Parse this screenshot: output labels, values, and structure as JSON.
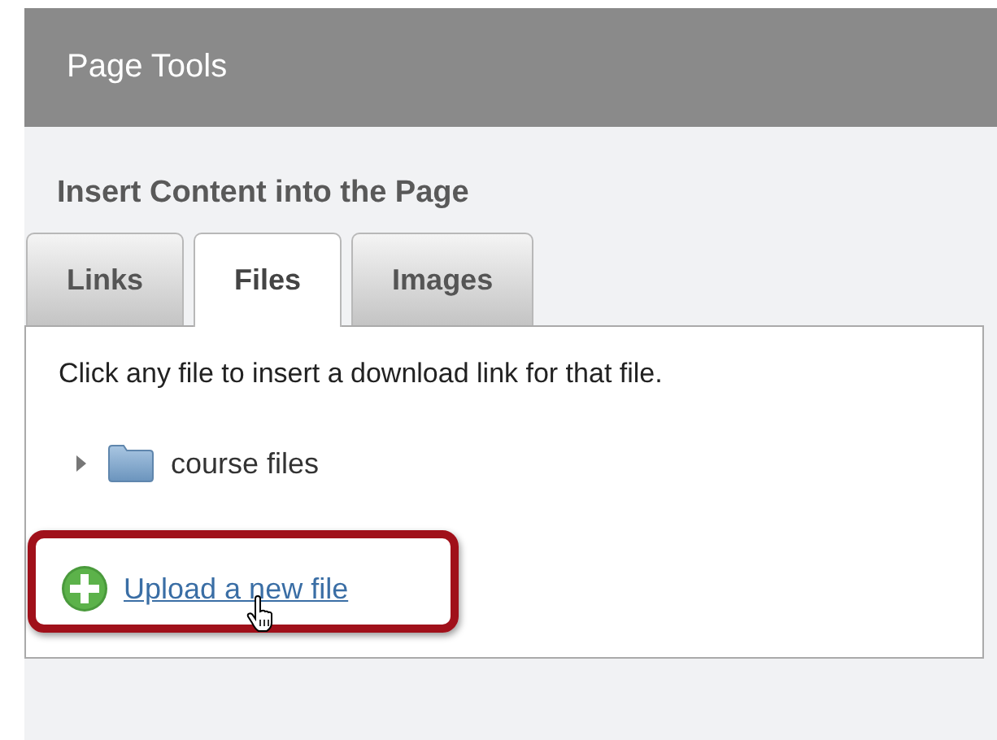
{
  "panel": {
    "title": "Page Tools"
  },
  "section": {
    "heading": "Insert Content into the Page"
  },
  "tabs": [
    {
      "label": "Links",
      "selected": false
    },
    {
      "label": "Files",
      "selected": true
    },
    {
      "label": "Images",
      "selected": false
    }
  ],
  "files_pane": {
    "instruction": "Click any file to insert a download link for that file.",
    "tree": [
      {
        "label": "course files",
        "expanded": false
      }
    ],
    "upload_link": {
      "label": "Upload a new file",
      "highlighted": true
    }
  }
}
